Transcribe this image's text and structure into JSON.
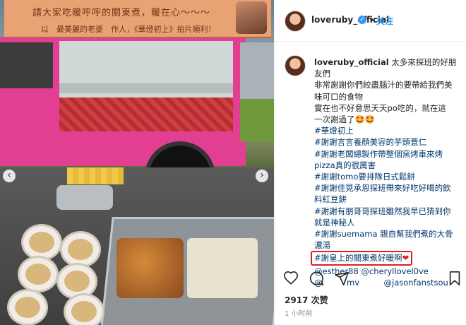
{
  "banner": {
    "line1": "請大家吃暖呼呼的關東煮，暖在心～～～",
    "line2": "以　最美麗的老婆　作人，《華燈初上》拍片順利！"
  },
  "post": {
    "username": "loveruby_official",
    "follow_label": "关注",
    "dot": "•",
    "caption_lines": [
      {
        "text": "太多來探班的好朋",
        "type": "first"
      },
      {
        "text": "友們",
        "type": "text"
      },
      {
        "text": "非常謝謝你們絞盡腦汁的要帶給我們美",
        "type": "text"
      },
      {
        "text": "味可口的食物",
        "type": "text"
      },
      {
        "text": "實在也不好意思天天po吃的，就在這",
        "type": "text"
      },
      {
        "text": "一次謝過了🤩🤩",
        "type": "text"
      },
      {
        "text": "#華燈初上",
        "type": "tag"
      },
      {
        "text": "#謝謝言言養顏美容的芋頭薏仁",
        "type": "tag"
      },
      {
        "text": "#謝謝老闆總製作帶整個窯烤車來烤",
        "type": "tag"
      },
      {
        "text": "pizza真的很厲害",
        "type": "tag"
      },
      {
        "text": "#謝謝tomo要排隊日式鬆餅",
        "type": "tag"
      },
      {
        "text": "#謝謝佳晃承恩探班帶來好吃好喝的飲",
        "type": "tag"
      },
      {
        "text": "料紅豆餅",
        "type": "tag"
      },
      {
        "text": "#謝謝有朋哥哥探班雖然我早已猜到你",
        "type": "tag"
      },
      {
        "text": "就是神秘人",
        "type": "tag"
      },
      {
        "text": "#謝謝suemama 親自幫我們煮的大骨",
        "type": "tag"
      },
      {
        "text": "濃湯",
        "type": "tag"
      },
      {
        "text": "#謝皇上的關東煮好暖啊",
        "type": "highlight"
      },
      {
        "text": "@esther88 @cheryllovel0ve",
        "type": "tag"
      },
      {
        "text": "@　　　mv　　　@jasonfanstsou",
        "type": "tag"
      }
    ],
    "heart": "❤",
    "likes": "2917 次赞",
    "time": "1 小时前"
  },
  "icons": [
    "heart-icon",
    "comment-icon",
    "share-icon",
    "bookmark-icon",
    "verified-badge-icon",
    "chevron-left-icon",
    "chevron-right-icon"
  ],
  "colors": {
    "accent": "#3897f0",
    "highlight": "#e0201b",
    "tag": "#00376b"
  }
}
